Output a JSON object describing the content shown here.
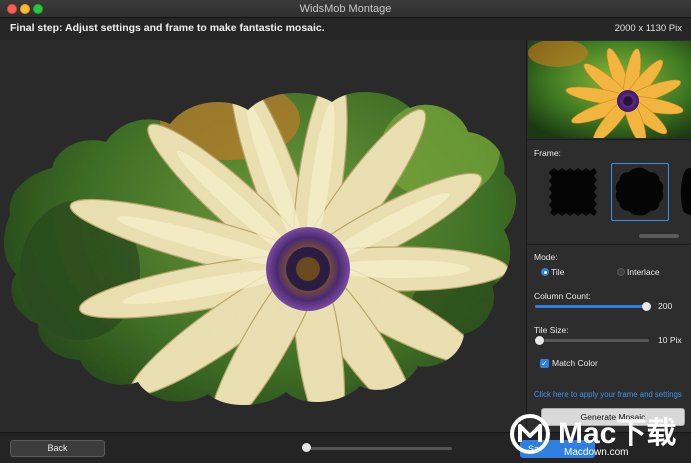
{
  "window": {
    "title": "WidsMob Montage"
  },
  "header": {
    "step_text": "Final step: Adjust settings and frame to make fantastic mosaic.",
    "dimensions": "2000 x 1130 Pix"
  },
  "panel": {
    "frame_label": "Frame:",
    "mode_label": "Mode:",
    "mode_options": [
      "Tile",
      "Interlace"
    ],
    "mode_selected": "Tile",
    "column_count_label": "Column Count:",
    "column_count_value": "200",
    "column_count_fraction": 0.97,
    "tile_size_label": "Tile Size:",
    "tile_size_value": "10 Pix",
    "tile_size_fraction": 0.0,
    "match_color_label": "Match Color",
    "match_color_checked": true,
    "apply_link": "Click here to apply your frame and settings",
    "generate_button": "Generate Mosaic"
  },
  "footer": {
    "back_button": "Back",
    "save_button": "Sa",
    "zoom_fraction": 0.0
  },
  "watermark": {
    "brand": "Mac下载",
    "site": "Macdown.com"
  },
  "colors": {
    "accent": "#2f7fe0",
    "link": "#3c95ee"
  }
}
